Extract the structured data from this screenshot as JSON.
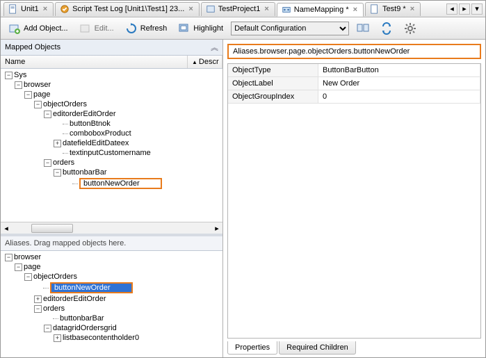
{
  "tabs": [
    {
      "label": "Unit1"
    },
    {
      "label": "Script Test Log [Unit1\\Test1] 23..."
    },
    {
      "label": "TestProject1"
    },
    {
      "label": "NameMapping *",
      "active": true
    },
    {
      "label": "Test9 *"
    }
  ],
  "toolbar": {
    "add": "Add Object...",
    "edit": "Edit...",
    "refresh": "Refresh",
    "highlight": "Highlight",
    "configSelected": "Default Configuration"
  },
  "mappedPanel": {
    "title": "Mapped Objects",
    "colName": "Name",
    "colDesc": "Descr"
  },
  "mappedTree": {
    "root": "Sys",
    "browser": "browser",
    "page": "page",
    "objectOrders": "objectOrders",
    "editorderEditOrder": "editorderEditOrder",
    "buttonBtnok": "buttonBtnok",
    "comboboxProduct": "comboboxProduct",
    "datefieldEditDateex": "datefieldEditDateex",
    "textinputCustomername": "textinputCustomername",
    "orders": "orders",
    "buttonbarBar": "buttonbarBar",
    "buttonNewOrder": "buttonNewOrder"
  },
  "aliasesPanel": {
    "hint": "Aliases. Drag mapped objects here."
  },
  "aliasesTree": {
    "browser": "browser",
    "page": "page",
    "objectOrders": "objectOrders",
    "buttonNewOrder": "buttonNewOrder",
    "editorderEditOrder": "editorderEditOrder",
    "orders": "orders",
    "buttonbarBar": "buttonbarBar",
    "datagridOrdersgrid": "datagridOrdersgrid",
    "listbasecontentholder0": "listbasecontentholder0"
  },
  "pathBox": "Aliases.browser.page.objectOrders.buttonNewOrder",
  "properties": [
    {
      "name": "ObjectType",
      "value": "ButtonBarButton"
    },
    {
      "name": "ObjectLabel",
      "value": "New Order"
    },
    {
      "name": "ObjectGroupIndex",
      "value": "0"
    }
  ],
  "bottomTabs": {
    "properties": "Properties",
    "required": "Required Children"
  }
}
